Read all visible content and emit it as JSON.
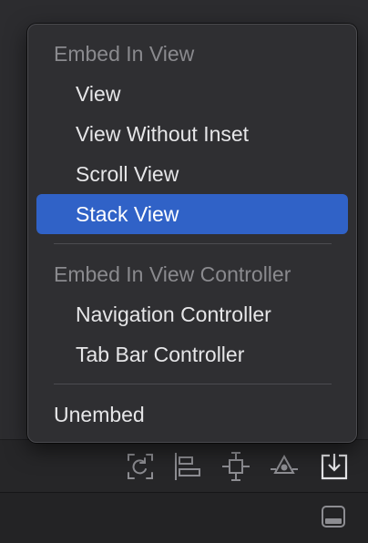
{
  "menu": {
    "embed_in_view_header": "Embed In View",
    "embed_in_view_items": [
      {
        "label": "View"
      },
      {
        "label": "View Without Inset"
      },
      {
        "label": "Scroll View"
      },
      {
        "label": "Stack View",
        "selected": true
      }
    ],
    "embed_in_view_controller_header": "Embed In View Controller",
    "embed_in_view_controller_items": [
      {
        "label": "Navigation Controller"
      },
      {
        "label": "Tab Bar Controller"
      }
    ],
    "unembed_label": "Unembed"
  },
  "toolbar": {
    "icons": [
      "update-frames-icon",
      "align-icon",
      "add-constraints-icon",
      "resolve-autolayout-issues-icon",
      "embed-in-icon"
    ]
  },
  "statusbar": {
    "icons": [
      "toggle-panel-icon"
    ]
  },
  "colors": {
    "selection": "#3062c7",
    "menu_background": "#2f2f32",
    "header_text": "#8a8a8e",
    "item_text": "#e6e6e8"
  }
}
